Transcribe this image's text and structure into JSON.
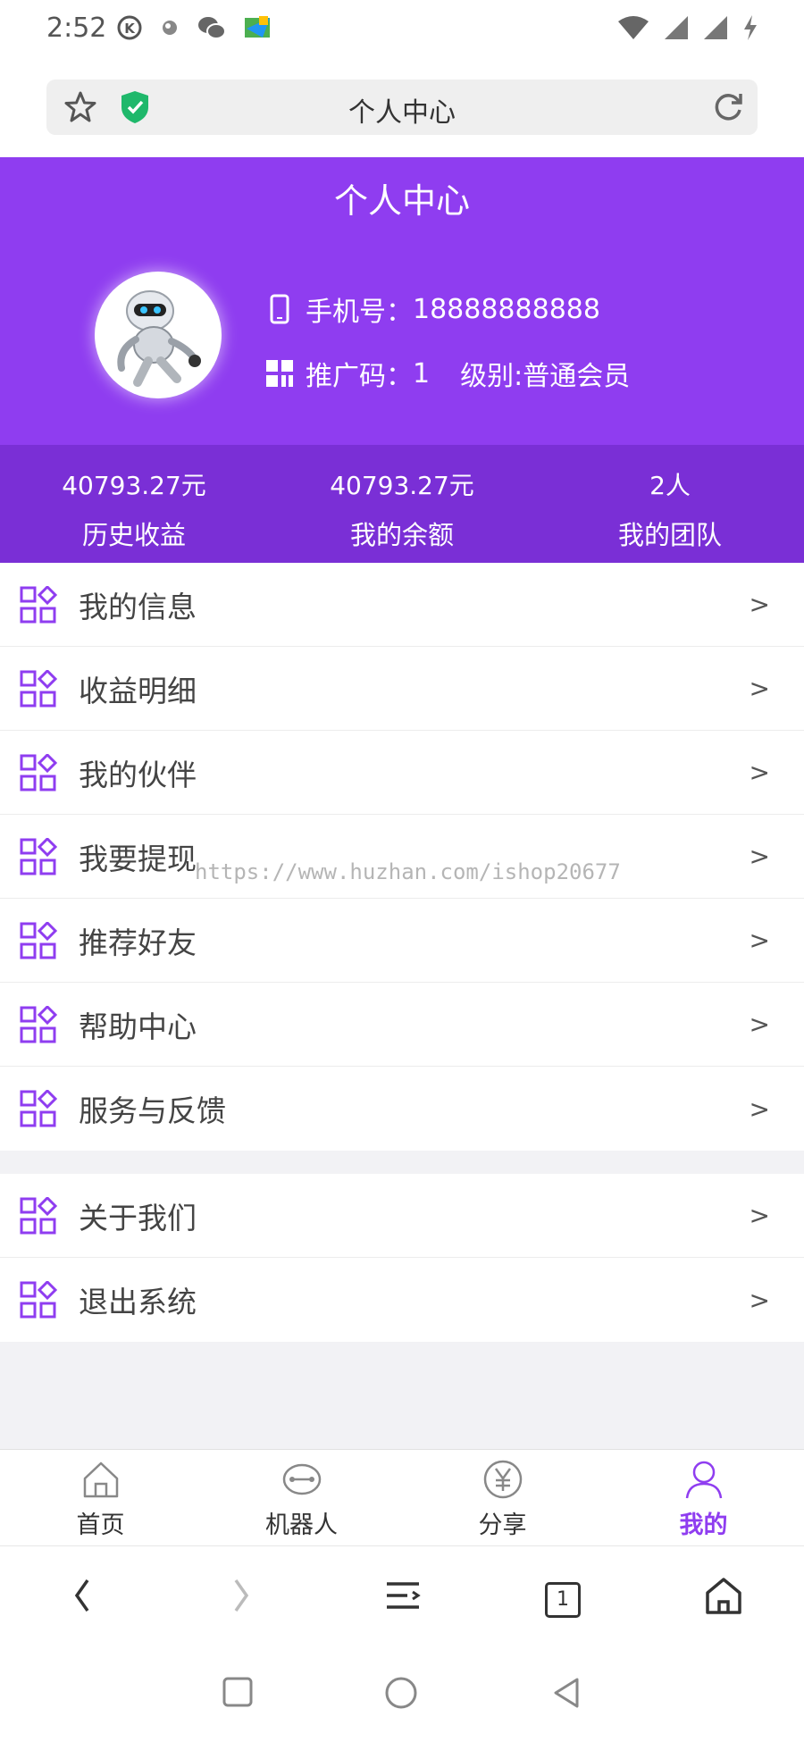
{
  "status_bar": {
    "time": "2:52"
  },
  "browser": {
    "address_title": "个人中心"
  },
  "header": {
    "title": "个人中心",
    "phone_label": "手机号：",
    "phone_value": "18888888888",
    "code_label": "推广码：",
    "code_value": "1",
    "level_label": "级别:",
    "level_value": "普通会员"
  },
  "stats": [
    {
      "value": "40793.27元",
      "label": "历史收益"
    },
    {
      "value": "40793.27元",
      "label": "我的余额"
    },
    {
      "value": "2人",
      "label": "我的团队"
    }
  ],
  "menu_group_1": [
    {
      "label": "我的信息",
      "arrow": ">"
    },
    {
      "label": "收益明细",
      "arrow": ">"
    },
    {
      "label": "我的伙伴",
      "arrow": ">"
    },
    {
      "label": "我要提现",
      "arrow": ">"
    },
    {
      "label": "推荐好友",
      "arrow": ">"
    },
    {
      "label": "帮助中心",
      "arrow": ">"
    },
    {
      "label": "服务与反馈",
      "arrow": ">"
    }
  ],
  "menu_group_2": [
    {
      "label": "关于我们",
      "arrow": ">"
    },
    {
      "label": "退出系统",
      "arrow": ">"
    }
  ],
  "watermark": "https://www.huzhan.com/ishop20677",
  "tabs": [
    {
      "label": "首页",
      "icon": "home-icon"
    },
    {
      "label": "机器人",
      "icon": "robot-icon"
    },
    {
      "label": "分享",
      "icon": "yen-icon"
    },
    {
      "label": "我的",
      "icon": "user-icon",
      "active": true
    }
  ],
  "browser_nav": {
    "tab_count": "1"
  },
  "colors": {
    "accent": "#8f3df0",
    "stats_bg": "#7a2fd6",
    "page_bg": "#f2f2f5"
  }
}
